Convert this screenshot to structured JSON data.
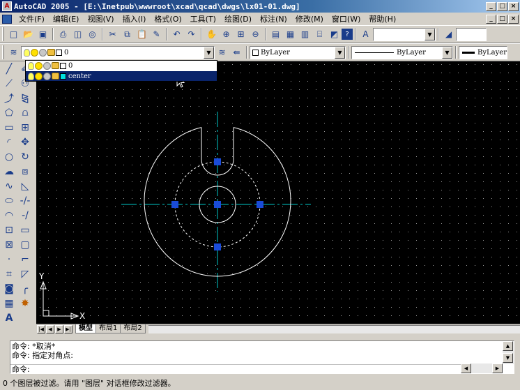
{
  "window": {
    "title": "AutoCAD 2005 - [E:\\Inetpub\\wwwroot\\xcad\\qcad\\dwgs\\lx01-01.dwg]",
    "app_icon": "autocad-icon",
    "controls": [
      "_",
      "□",
      "×"
    ]
  },
  "menubar": {
    "items": [
      "文件(F)",
      "编辑(E)",
      "视图(V)",
      "插入(I)",
      "格式(O)",
      "工具(T)",
      "绘图(D)",
      "标注(N)",
      "修改(M)",
      "窗口(W)",
      "帮助(H)"
    ],
    "doc_controls": [
      "_",
      "□",
      "×"
    ]
  },
  "toolbar_standard": {
    "icons": [
      "new-icon",
      "open-icon",
      "save-icon",
      "print-icon",
      "preview-icon",
      "publish-icon",
      "cut-icon",
      "copy-icon",
      "paste-icon",
      "match-icon",
      "undo-icon",
      "redo-icon",
      "pan-icon",
      "zoom-realtime-icon",
      "zoom-window-icon",
      "zoom-prev-icon",
      "properties-icon",
      "design-center-icon",
      "tool-palette-icon",
      "dbconnect-icon",
      "markup-icon",
      "help-icon"
    ],
    "text_style_value": "",
    "dim_style_value": ""
  },
  "toolbar_layers": {
    "layer_combo_value": "0",
    "color_combo_value": "ByLayer",
    "linetype_combo_value": "ByLayer",
    "lineweight_combo_value": "ByLayer"
  },
  "layer_dropdown": {
    "rows": [
      {
        "name": "0",
        "color": "#ffffff",
        "selected": false
      },
      {
        "name": "center",
        "color": "#00e0e0",
        "selected": true
      }
    ]
  },
  "draw_toolbar": {
    "icons": [
      "line-icon",
      "construction-line-icon",
      "polyline-icon",
      "polygon-icon",
      "rectangle-icon",
      "arc-icon",
      "circle-icon",
      "revision-cloud-icon",
      "spline-icon",
      "ellipse-icon",
      "ellipse-arc-icon",
      "insert-block-icon",
      "make-block-icon",
      "point-icon",
      "hatch-icon",
      "region-icon",
      "table-icon",
      "mtext-icon"
    ]
  },
  "modify_toolbar": {
    "icons": [
      "erase-icon",
      "copy-object-icon",
      "mirror-icon",
      "offset-icon",
      "array-icon",
      "move-icon",
      "rotate-icon",
      "scale-icon",
      "stretch-icon",
      "trim-icon",
      "extend-icon",
      "break-point-icon",
      "break-icon",
      "join-icon",
      "chamfer-icon",
      "fillet-icon",
      "explode-icon"
    ]
  },
  "ucs": {
    "x_label": "X",
    "y_label": "Y"
  },
  "layout_tabs": {
    "tabs": [
      "模型",
      "布局1",
      "布局2"
    ],
    "active": "模型"
  },
  "command": {
    "history": [
      "命令: *取消*",
      "命令: 指定对角点:"
    ],
    "prompt": "命令:"
  },
  "status": {
    "text": "0 个图层被过滤。请用 \"图层\" 对话框修改过滤器。"
  },
  "colors": {
    "canvas": "#000000",
    "geometry": "#ffffff",
    "centerline": "#00c8c8",
    "grip": "#1a4bd8",
    "grid_dot": "#9a9a9a"
  }
}
